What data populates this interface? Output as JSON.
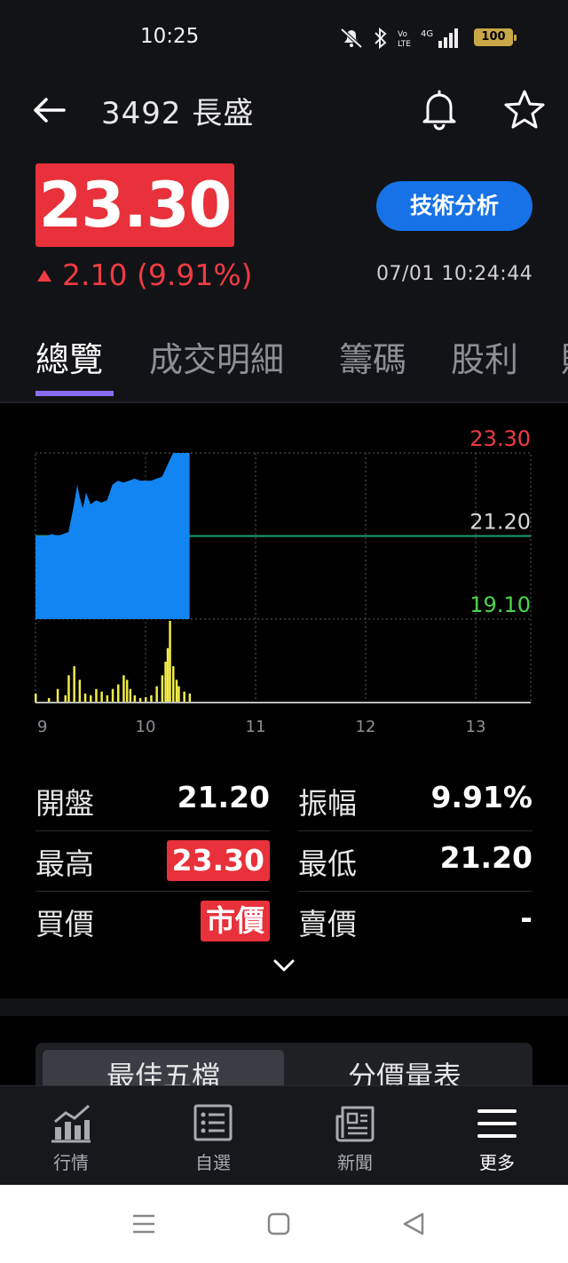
{
  "status_bar": {
    "time": "10:25",
    "battery": "100",
    "icons": [
      "mute-icon",
      "bluetooth-icon",
      "volte-icon",
      "signal-4g-icon",
      "battery-icon"
    ]
  },
  "header": {
    "title": "3492 長盛"
  },
  "quote": {
    "price": "23.30",
    "change": "2.10 (9.91%)",
    "timestamp": "07/01 10:24:44",
    "tech_button": "技術分析",
    "up_color": "#e8313a"
  },
  "tabs": [
    {
      "label": "總覽",
      "active": true
    },
    {
      "label": "成交明細",
      "active": false
    },
    {
      "label": "籌碼",
      "active": false
    },
    {
      "label": "股利",
      "active": false
    }
  ],
  "chart_data": {
    "type": "area",
    "y_labels": [
      "23.30",
      "21.20",
      "19.10"
    ],
    "ylim": [
      19.1,
      23.3
    ],
    "reference": 21.2,
    "x_ticks": [
      "9",
      "10",
      "11",
      "12",
      "13"
    ],
    "xlim": [
      9,
      13.5
    ],
    "price_series": {
      "x": [
        9.0,
        9.1,
        9.15,
        9.2,
        9.3,
        9.35,
        9.38,
        9.4,
        9.43,
        9.46,
        9.5,
        9.55,
        9.6,
        9.65,
        9.7,
        9.75,
        9.8,
        9.85,
        9.9,
        9.95,
        10.0,
        10.05,
        10.1,
        10.15,
        10.2,
        10.25,
        10.3,
        10.32,
        10.35,
        10.4
      ],
      "y": [
        21.2,
        21.2,
        21.25,
        21.2,
        21.3,
        22.0,
        22.5,
        22.2,
        21.9,
        22.3,
        22.0,
        22.1,
        22.05,
        22.1,
        22.5,
        22.6,
        22.55,
        22.6,
        22.65,
        22.6,
        22.6,
        22.6,
        22.65,
        22.7,
        23.0,
        23.3,
        23.3,
        23.3,
        23.3,
        23.3
      ]
    },
    "volume_series": {
      "x": [
        9.0,
        9.12,
        9.2,
        9.27,
        9.3,
        9.35,
        9.4,
        9.45,
        9.5,
        9.55,
        9.6,
        9.65,
        9.7,
        9.75,
        9.8,
        9.83,
        9.86,
        9.9,
        9.95,
        10.0,
        10.05,
        10.1,
        10.15,
        10.18,
        10.2,
        10.22,
        10.25,
        10.28,
        10.3,
        10.35,
        10.4
      ],
      "y": [
        10,
        5,
        15,
        8,
        30,
        40,
        25,
        10,
        8,
        15,
        12,
        8,
        15,
        20,
        30,
        25,
        15,
        8,
        5,
        6,
        8,
        18,
        30,
        45,
        60,
        90,
        40,
        25,
        18,
        12,
        10
      ]
    },
    "area_color": "#1385f2",
    "volume_color": "#f2ec4a",
    "reference_color": "#1fa07a",
    "high_label_color": "#ef3b43",
    "mid_label_color": "#d6d6d6",
    "low_label_color": "#4ad64a"
  },
  "stats": {
    "open_label": "開盤",
    "open_value": "21.20",
    "amp_label": "振幅",
    "amp_value": "9.91%",
    "high_label": "最高",
    "high_value": "23.30",
    "low_label": "最低",
    "low_value": "21.20",
    "bid_label": "買價",
    "bid_value": "市價",
    "ask_label": "賣價",
    "ask_value": "-"
  },
  "segment": {
    "items": [
      "最佳五檔",
      "分價量表"
    ]
  },
  "bottom_nav": [
    {
      "label": "行情",
      "icon": "chart-bars-icon"
    },
    {
      "label": "自選",
      "icon": "list-icon"
    },
    {
      "label": "新聞",
      "icon": "news-icon"
    },
    {
      "label": "更多",
      "icon": "menu-icon"
    }
  ]
}
